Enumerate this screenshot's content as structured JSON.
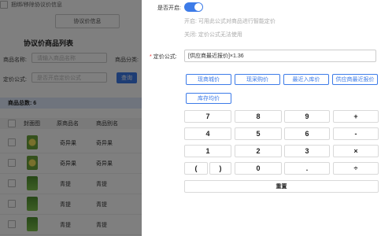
{
  "background": {
    "top_label": "捆绑/移除协议价信息",
    "price_button": "协议价信息",
    "list_title": "协议价商品列表",
    "filters": {
      "name_label": "商品名称:",
      "name_placeholder": "请输入商品名称",
      "category_label": "商品分类:",
      "formula_label": "定价公式:",
      "formula_placeholder": "是否开启定价公式",
      "query_button": "查询"
    },
    "total": "商品总数: 6",
    "columns": [
      "封面图",
      "原商品名",
      "商品别名"
    ],
    "rows": [
      {
        "thumb": "yellow",
        "name": "奇异果",
        "alias": "奇异果"
      },
      {
        "thumb": "yellow",
        "name": "奇异果",
        "alias": "奇异果"
      },
      {
        "thumb": "green",
        "name": "青提",
        "alias": "青提"
      },
      {
        "thumb": "green",
        "name": "青提",
        "alias": "青提"
      },
      {
        "thumb": "green",
        "name": "青提",
        "alias": "青提"
      }
    ]
  },
  "drawer": {
    "enable_label": "是否开启:",
    "enable_on": true,
    "hint_on": "开启: 可用此公式对商品进行智能定价",
    "hint_off": "关闭: 定价公式无法使用",
    "required_mark": "*",
    "formula_label": "定价公式:",
    "formula_value": "[供应商最近报价]×1.36",
    "variables": [
      "现商城价",
      "现采购价",
      "最近入库价",
      "供应商最近报价",
      "库存均价"
    ],
    "keypad": [
      [
        "7",
        "8",
        "9",
        "+"
      ],
      [
        "4",
        "5",
        "6",
        "-"
      ],
      [
        "1",
        "2",
        "3",
        "×"
      ],
      [
        "(",
        ")",
        "0",
        ".",
        "÷"
      ]
    ],
    "reset_label": "重置"
  },
  "colors": {
    "accent": "#3d7be8",
    "overlay": "rgba(0,0,0,0.5)"
  }
}
